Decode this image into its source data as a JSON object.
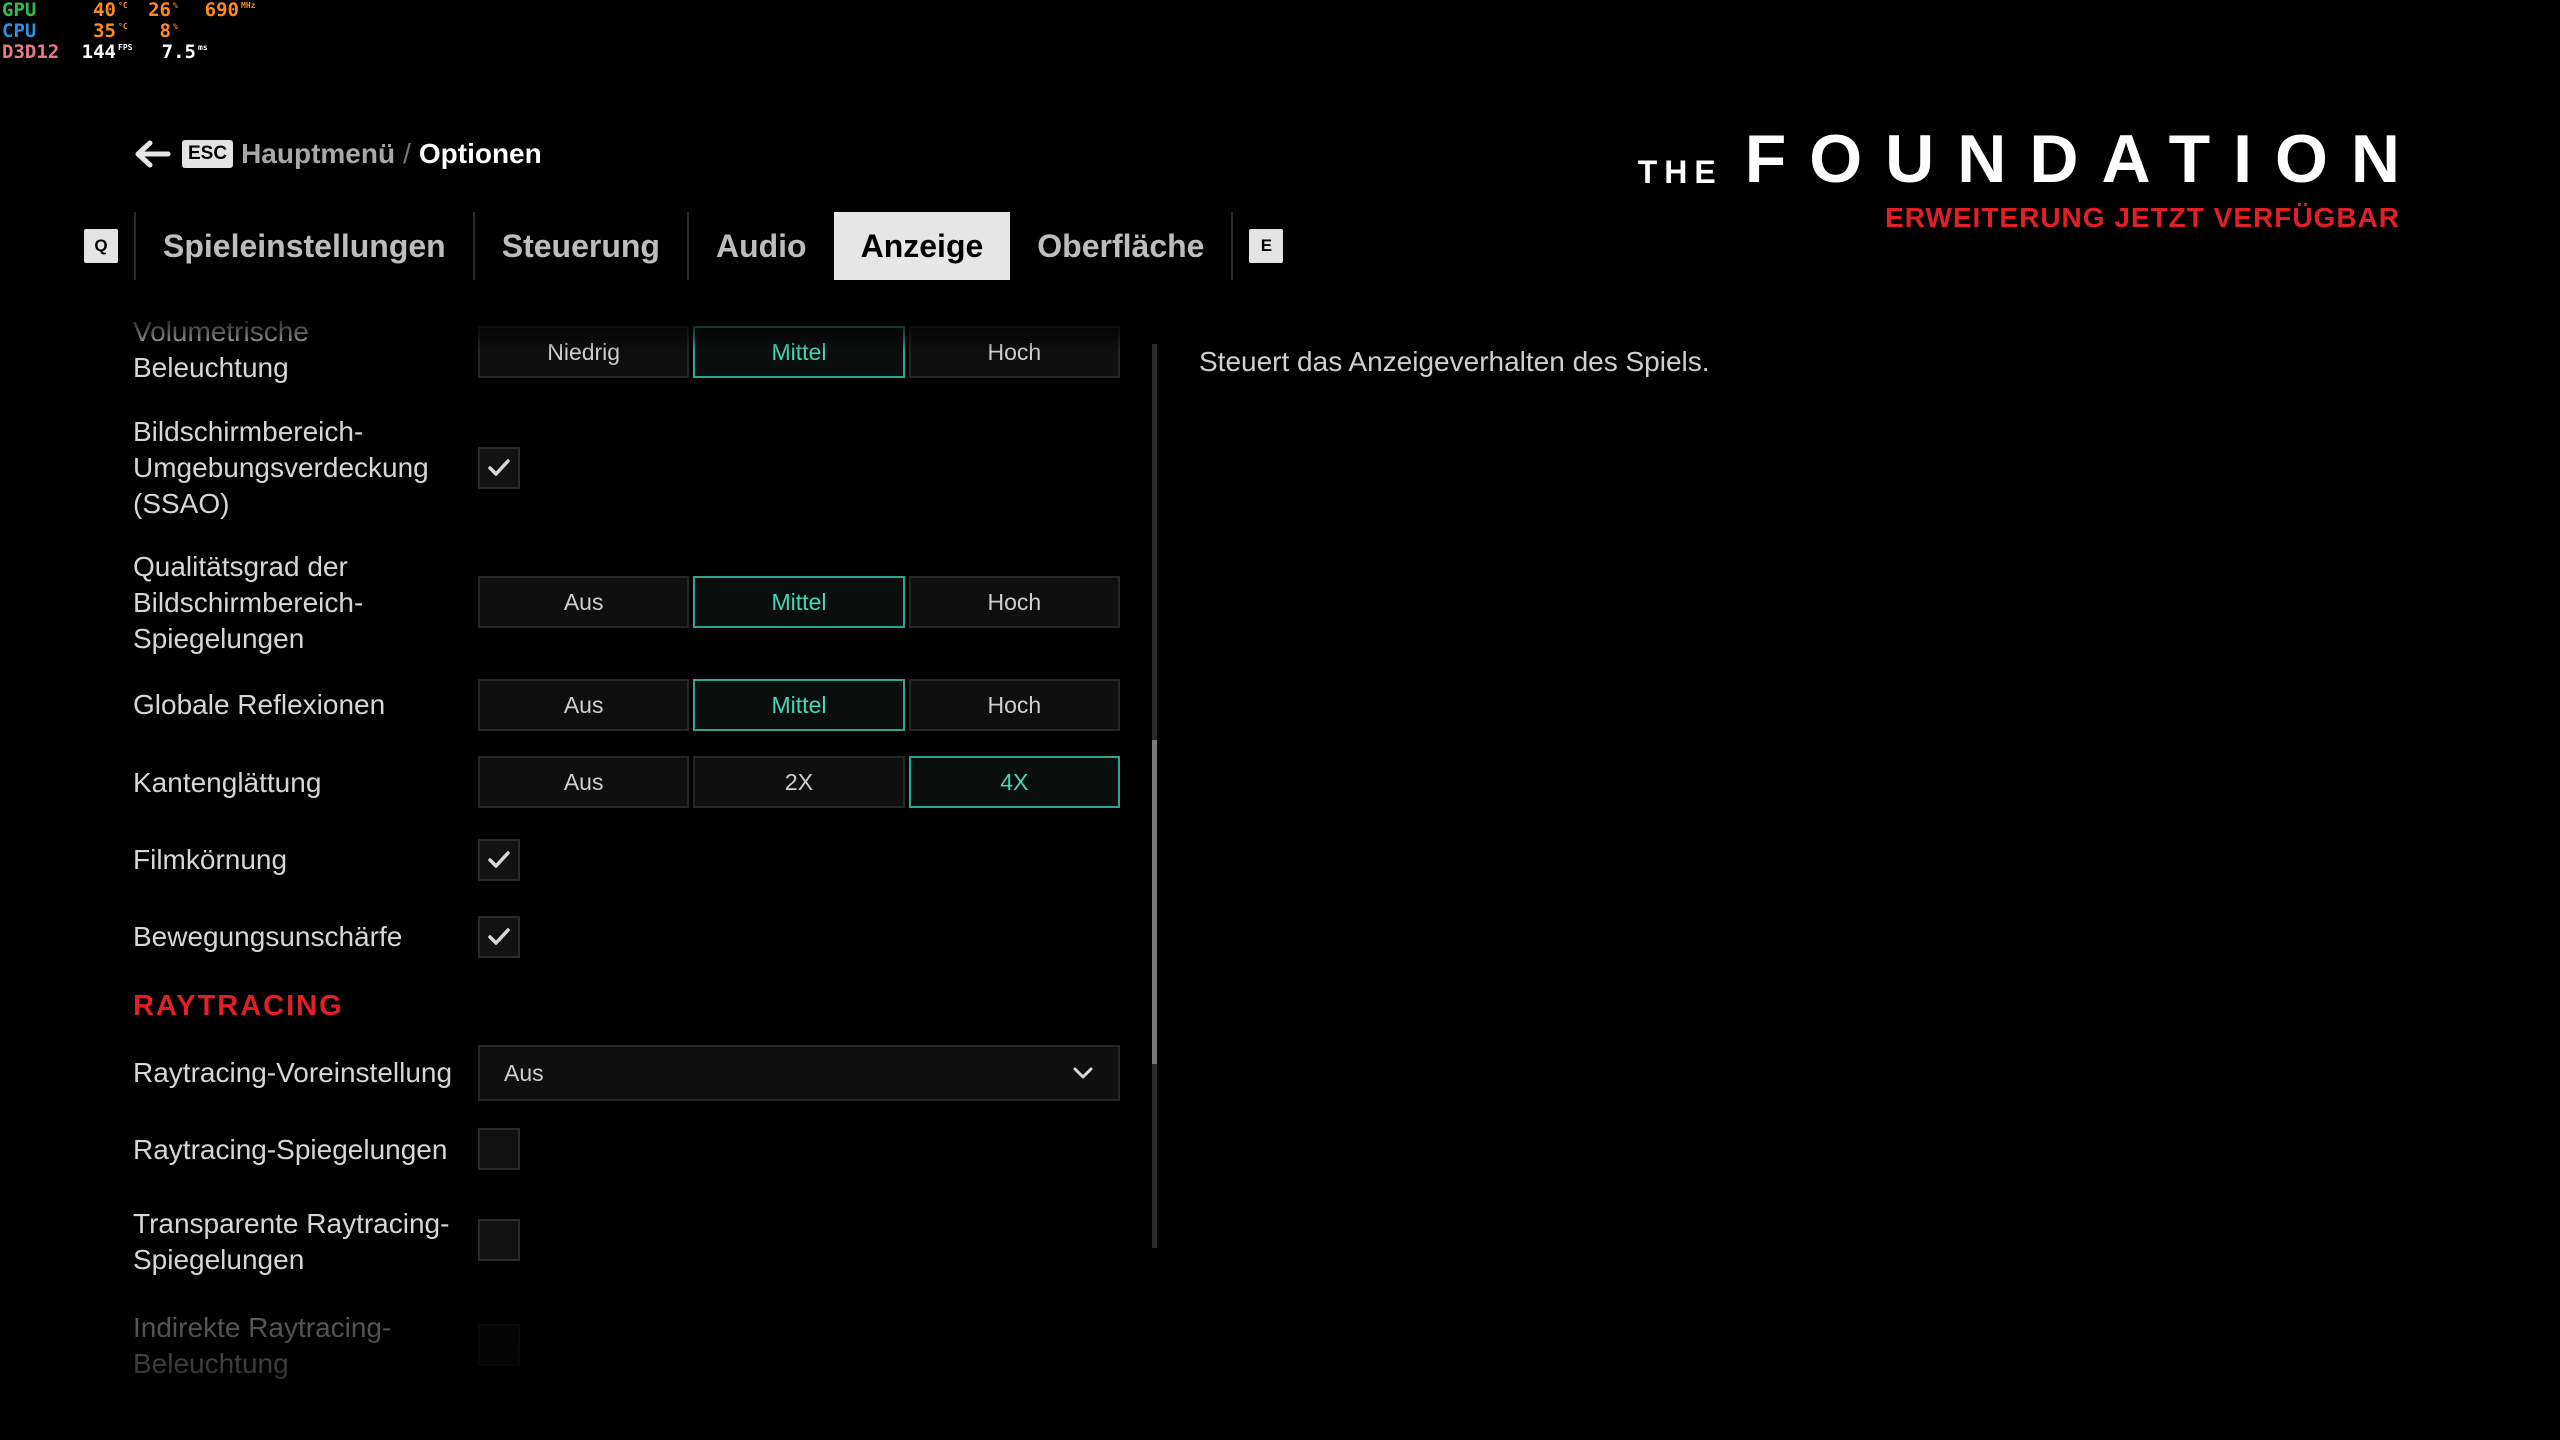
{
  "overlay": {
    "gpu": {
      "label": "GPU",
      "temp": "40",
      "temp_unit": "°C",
      "load": "26",
      "load_unit": "%",
      "clock": "690",
      "clock_unit": "MHz"
    },
    "cpu": {
      "label": "CPU",
      "temp": "35",
      "temp_unit": "°C",
      "load": "8",
      "load_unit": "%"
    },
    "api": {
      "label": "D3D12",
      "fps": "144",
      "fps_unit": "FPS",
      "frametime": "7.5",
      "frametime_unit": "ms"
    },
    "colors": {
      "gpu": "#2fbf4a",
      "cpu": "#2f8fe0",
      "api": "#e87a8a",
      "value": "#ff8a1f",
      "api_value": "#ffffff"
    }
  },
  "breadcrumb": {
    "key": "ESC",
    "parent": "Hauptmenü",
    "separator": "/",
    "current": "Optionen"
  },
  "tabs": {
    "prev_key": "Q",
    "next_key": "E",
    "items": [
      "Spieleinstellungen",
      "Steuerung",
      "Audio",
      "Anzeige",
      "Oberfläche"
    ],
    "active": "Anzeige"
  },
  "logo": {
    "the": "THE",
    "main": "FOUNDATION",
    "sub": "ERWEITERUNG JETZT VERFÜGBAR",
    "accent": "#e01f26"
  },
  "settings": {
    "volumetric": {
      "label": "Volumetrische Beleuchtung",
      "options": [
        "Niedrig",
        "Mittel",
        "Hoch"
      ],
      "selected": "Mittel"
    },
    "ssao": {
      "label": "Bildschirmbereich-Umgebungsverdeckung (SSAO)",
      "checked": true
    },
    "ssr": {
      "label": "Qualitätsgrad der Bildschirmbereich-Spiegelungen",
      "options": [
        "Aus",
        "Mittel",
        "Hoch"
      ],
      "selected": "Mittel"
    },
    "global_reflections": {
      "label": "Globale Reflexionen",
      "options": [
        "Aus",
        "Mittel",
        "Hoch"
      ],
      "selected": "Mittel"
    },
    "antialiasing": {
      "label": "Kantenglättung",
      "options": [
        "Aus",
        "2X",
        "4X"
      ],
      "selected": "4X"
    },
    "film_grain": {
      "label": "Filmkörnung",
      "checked": true
    },
    "motion_blur": {
      "label": "Bewegungsunschärfe",
      "checked": true
    },
    "raytracing_section": "RAYTRACING",
    "rt_preset": {
      "label": "Raytracing-Voreinstellung",
      "value": "Aus"
    },
    "rt_reflections": {
      "label": "Raytracing-Spiegelungen",
      "checked": false
    },
    "rt_transparent": {
      "label": "Transparente Raytracing-Spiegelungen",
      "checked": false
    },
    "rt_indirect": {
      "label": "Indirekte Raytracing-Beleuchtung",
      "checked": false
    }
  },
  "description": "Steuert das Anzeigeverhalten des Spiels.",
  "colors": {
    "selected": "#44d8b6",
    "selected_border": "#2aa78f",
    "section": "#e01f26"
  }
}
